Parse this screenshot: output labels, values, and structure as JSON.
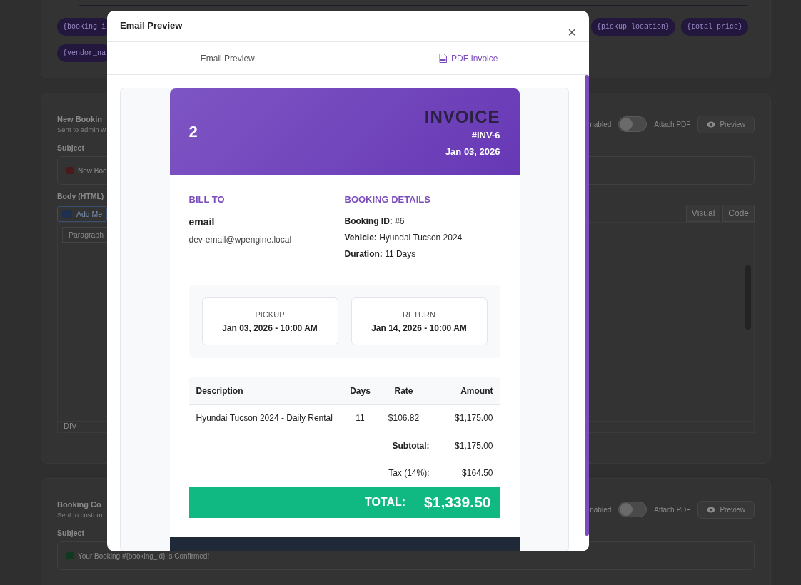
{
  "background": {
    "chips_row_1": [
      "{booking_i",
      "{pickup_location}",
      "{total_price}"
    ],
    "chips_row_2": [
      "{vendor_na"
    ],
    "cards": [
      {
        "kind": "editor",
        "title": "New Bookin",
        "subtitle": "Sent to admin w",
        "enabled_label": "nabled",
        "attach_label": "Attach PDF",
        "attach_on": false,
        "preview_label": "Preview",
        "subject_label": "Subject",
        "subject_value": "New Boo",
        "body_label": "Body (HTML)",
        "add_media": "Add Me",
        "tabs": [
          "Visual",
          "Code"
        ],
        "format": "Paragraph",
        "status": "DIV"
      },
      {
        "kind": "subject",
        "title": "Booking Co",
        "subtitle": "Sent to custom",
        "enabled_label": "nabled",
        "attach_label": "Attach PDF",
        "attach_on": false,
        "preview_label": "Preview",
        "subject_label": "Subject",
        "subject_value": "Your Booking #{booking_id} is Confirmed!"
      }
    ]
  },
  "modal": {
    "title": "Email Preview",
    "close": "×",
    "tabs": [
      {
        "label": "Email Preview",
        "selected": false
      },
      {
        "label": "PDF Invoice",
        "selected": true
      }
    ],
    "invoice": {
      "number_mark": "2",
      "title": "INVOICE",
      "invoice_no": "#INV-6",
      "date": "Jan 03, 2026",
      "bill_to": {
        "heading": "BILL TO",
        "name": "email",
        "email": "dev-email@wpengine.local"
      },
      "booking": {
        "heading": "BOOKING DETAILS",
        "lines": [
          "**Booking ID:** #6",
          "**Vehicle:** Hyundai Tucson 2024",
          "**Duration:** 11 Days"
        ]
      },
      "dates": [
        {
          "label": "PICKUP",
          "value": "Jan 03, 2026 - 10:00 AM"
        },
        {
          "label": "RETURN",
          "value": "Jan 14, 2026 - 10:00 AM"
        }
      ],
      "table": {
        "columns": [
          "Description",
          "Days",
          "Rate",
          "Amount"
        ],
        "rows": [
          [
            "Hyundai Tucson 2024 - Daily Rental",
            "11",
            "$106.82",
            "$1,175.00"
          ]
        ]
      },
      "subtotal": {
        "label": "Subtotal:",
        "value": "$1,175.00"
      },
      "tax": {
        "label": "Tax (14%):",
        "value": "$164.50"
      },
      "total": {
        "label": "TOTAL:",
        "value": "$1,339.50"
      }
    }
  }
}
